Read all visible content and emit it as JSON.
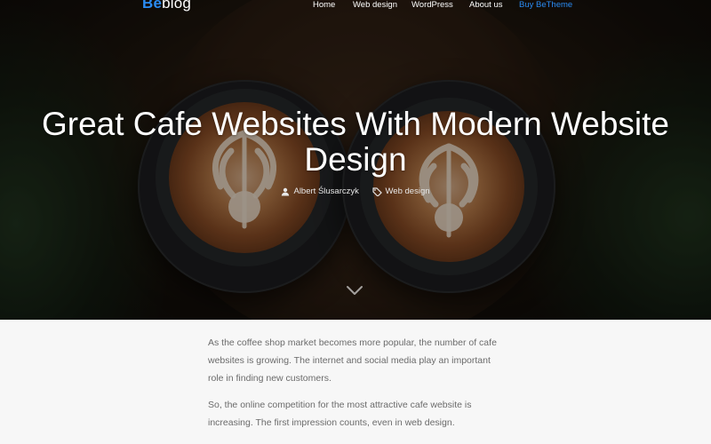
{
  "logo": {
    "be": "Be",
    "blog": "blog"
  },
  "nav": {
    "items": [
      {
        "label": "Home"
      },
      {
        "label": "Web design"
      },
      {
        "label": "WordPress"
      },
      {
        "label": "About us"
      },
      {
        "label": "Buy BeTheme"
      }
    ],
    "accent_color": "#2a8bf2"
  },
  "hero": {
    "title": "Great Cafe Websites With Modern Website Design",
    "author": "Albert Ślusarczyk",
    "category": "Web design",
    "icons": {
      "author": "user-icon",
      "category": "tag-icon",
      "scroll": "chevron-down-icon"
    }
  },
  "article": {
    "paragraphs": [
      "As the coffee shop market becomes more popular, the number of cafe websites is growing. The internet and social media play an important role in finding new customers.",
      "So, the online competition for the most attractive cafe website is increasing. The first impression counts, even in web design."
    ]
  }
}
